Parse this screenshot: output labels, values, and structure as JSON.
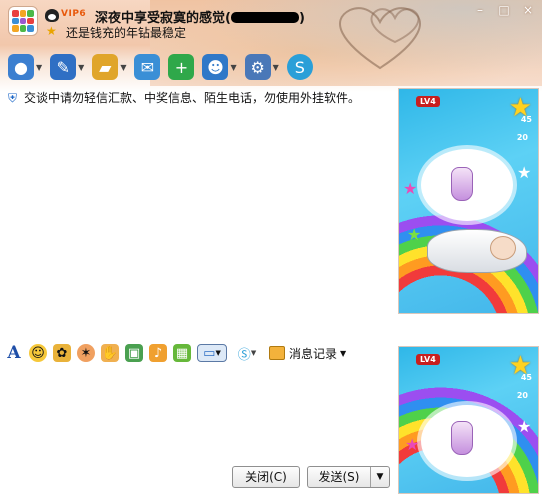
{
  "window": {
    "vip_label": "VIP6",
    "contact_name": "深夜中享受寂寞的感觉(",
    "contact_name_suffix": ")",
    "signature": "还是钱充的年钻最稳定",
    "controls": [
      "–",
      "□",
      "×"
    ]
  },
  "toolbar": {
    "items": [
      {
        "name": "video-call",
        "icon": "webcam-icon",
        "color": "#3b7fd0",
        "has_dropdown": true
      },
      {
        "name": "voice-call",
        "icon": "microphone-icon",
        "color": "#2f6fc4",
        "has_dropdown": true
      },
      {
        "name": "send-file",
        "icon": "folder-icon",
        "color": "#e0a52a",
        "has_dropdown": true
      },
      {
        "name": "send-sms",
        "icon": "mail-icon",
        "color": "#3a8fd6",
        "has_dropdown": false
      },
      {
        "name": "create-discussion",
        "icon": "group-add-icon",
        "color": "#2fa84a",
        "has_dropdown": false
      },
      {
        "name": "remote-assist",
        "icon": "people-icon",
        "color": "#2f78c8",
        "has_dropdown": true
      },
      {
        "name": "apps",
        "icon": "gear-icon",
        "color": "#4a78b8",
        "has_dropdown": true
      },
      {
        "name": "soso",
        "icon": "s-logo-icon",
        "color": "#2a9fd8",
        "has_dropdown": false
      }
    ]
  },
  "warning": {
    "text": "交谈中请勿轻信汇款、中奖信息、陌生电话，勿使用外挂软件。"
  },
  "format_bar": {
    "font_label": "A",
    "history_label": "消息记录"
  },
  "buttons": {
    "close_label": "关闭(C)",
    "send_label": "发送(S)"
  },
  "show_panel": {
    "level_label": "LV4",
    "score_1": "45",
    "score_2": "20"
  }
}
